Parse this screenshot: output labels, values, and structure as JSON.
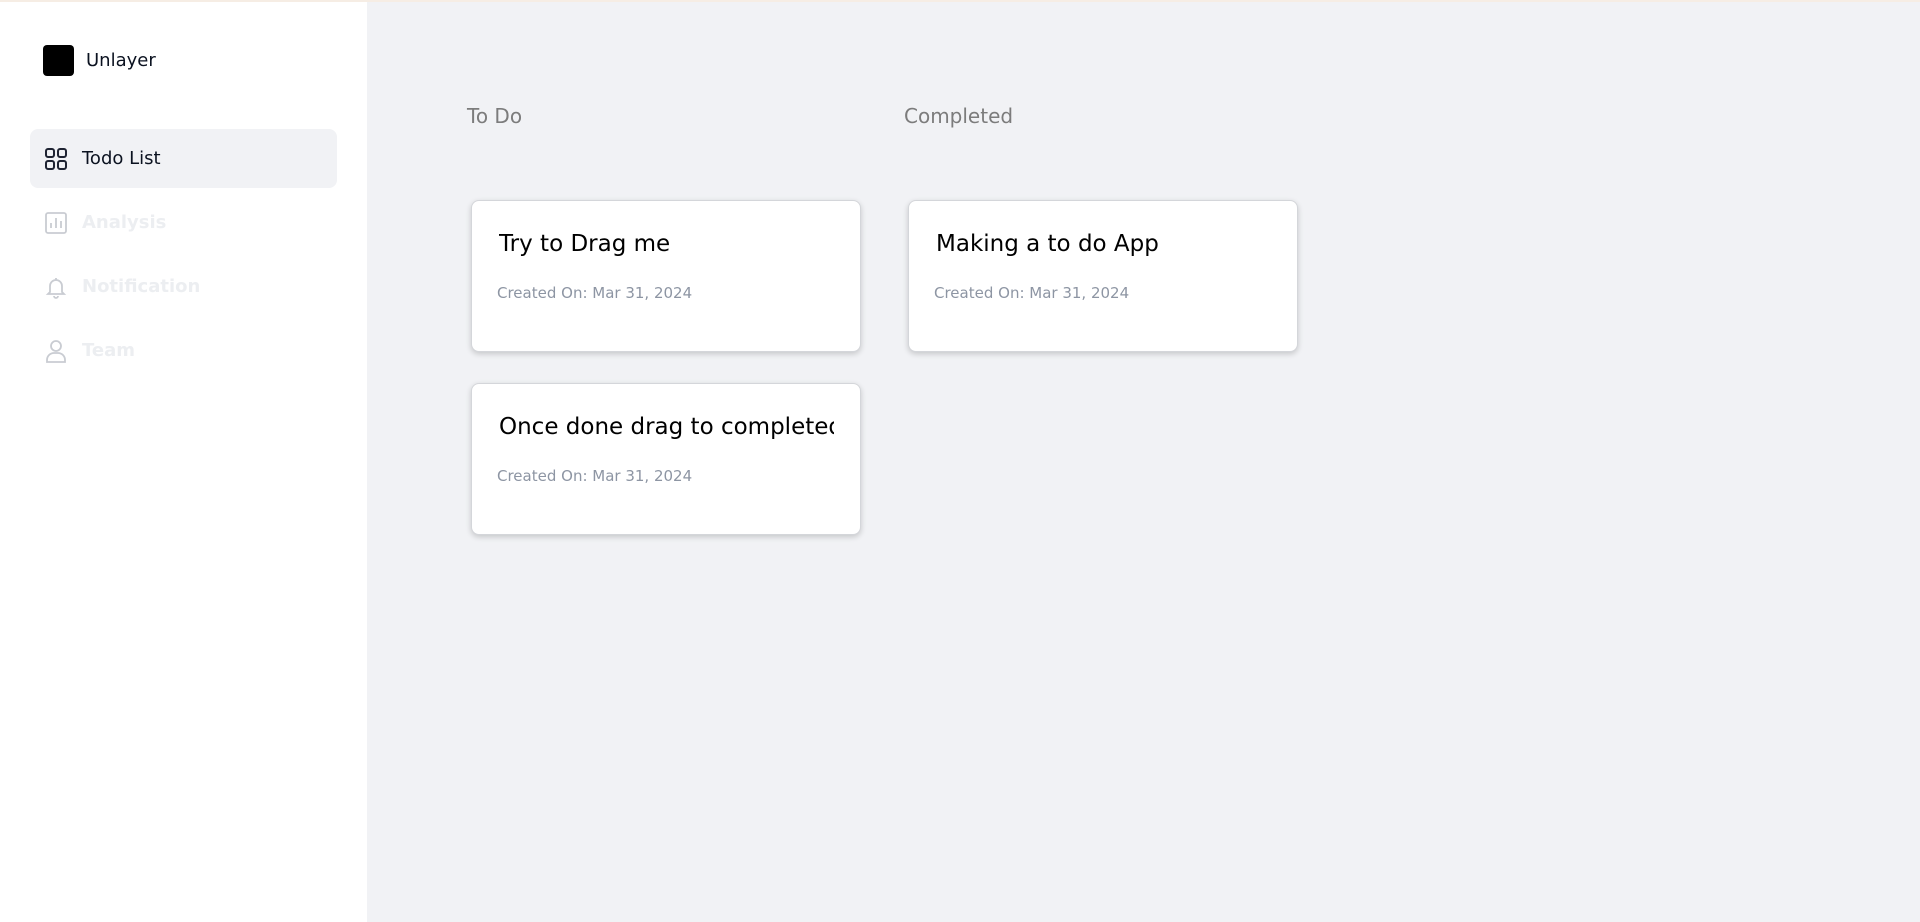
{
  "brand": {
    "name": "Unlayer"
  },
  "nav": {
    "items": [
      {
        "label": "Todo List",
        "icon": "grid-icon",
        "active": true
      },
      {
        "label": "Analysis",
        "icon": "chart-icon",
        "active": false
      },
      {
        "label": "Notification",
        "icon": "bell-icon",
        "active": false
      },
      {
        "label": "Team",
        "icon": "user-icon",
        "active": false
      }
    ]
  },
  "board": {
    "columns": [
      {
        "title": "To Do",
        "cards": [
          {
            "title": "Try to Drag me",
            "created": "Created On: Mar 31, 2024"
          },
          {
            "title": "Once done drag to completed",
            "created": "Created On: Mar 31, 2024"
          }
        ]
      },
      {
        "title": "Completed",
        "cards": [
          {
            "title": "Making a to do App",
            "created": "Created On: Mar 31, 2024"
          }
        ]
      }
    ]
  },
  "colors": {
    "sidebar_bg": "#ffffff",
    "main_bg": "#f1f2f5",
    "active_nav_bg": "#f1f2f5",
    "column_title": "#7c7c7c",
    "card_date": "#8d95a3"
  }
}
